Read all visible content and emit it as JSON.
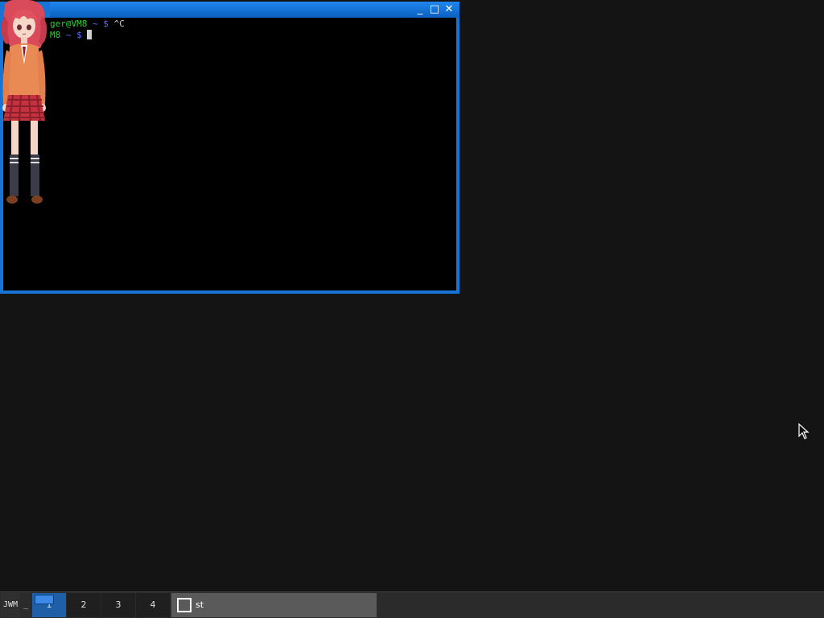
{
  "terminal": {
    "line1": {
      "user_host": "ger@VM8",
      "path": "~",
      "symbol": "$",
      "command": "^C"
    },
    "line2": {
      "user_host": "M8",
      "path": "~",
      "symbol": "$"
    },
    "titlebar_buttons": {
      "minimize": "_",
      "maximize": "□",
      "close": "✕"
    }
  },
  "taskbar": {
    "start_label": "JWM",
    "show_desktop_label": "_",
    "workspaces": [
      "1",
      "2",
      "3",
      "4"
    ],
    "active_workspace": "1",
    "tasks": [
      {
        "label": "st",
        "icon": "window-icon"
      }
    ]
  },
  "colors": {
    "desktop": "#141414",
    "window_border": "#1674d6",
    "prompt_user": "#2fd12f",
    "prompt_path": "#5f6bff",
    "taskbar": "#2b2b2b",
    "active_workspace": "#1e5fa8"
  }
}
